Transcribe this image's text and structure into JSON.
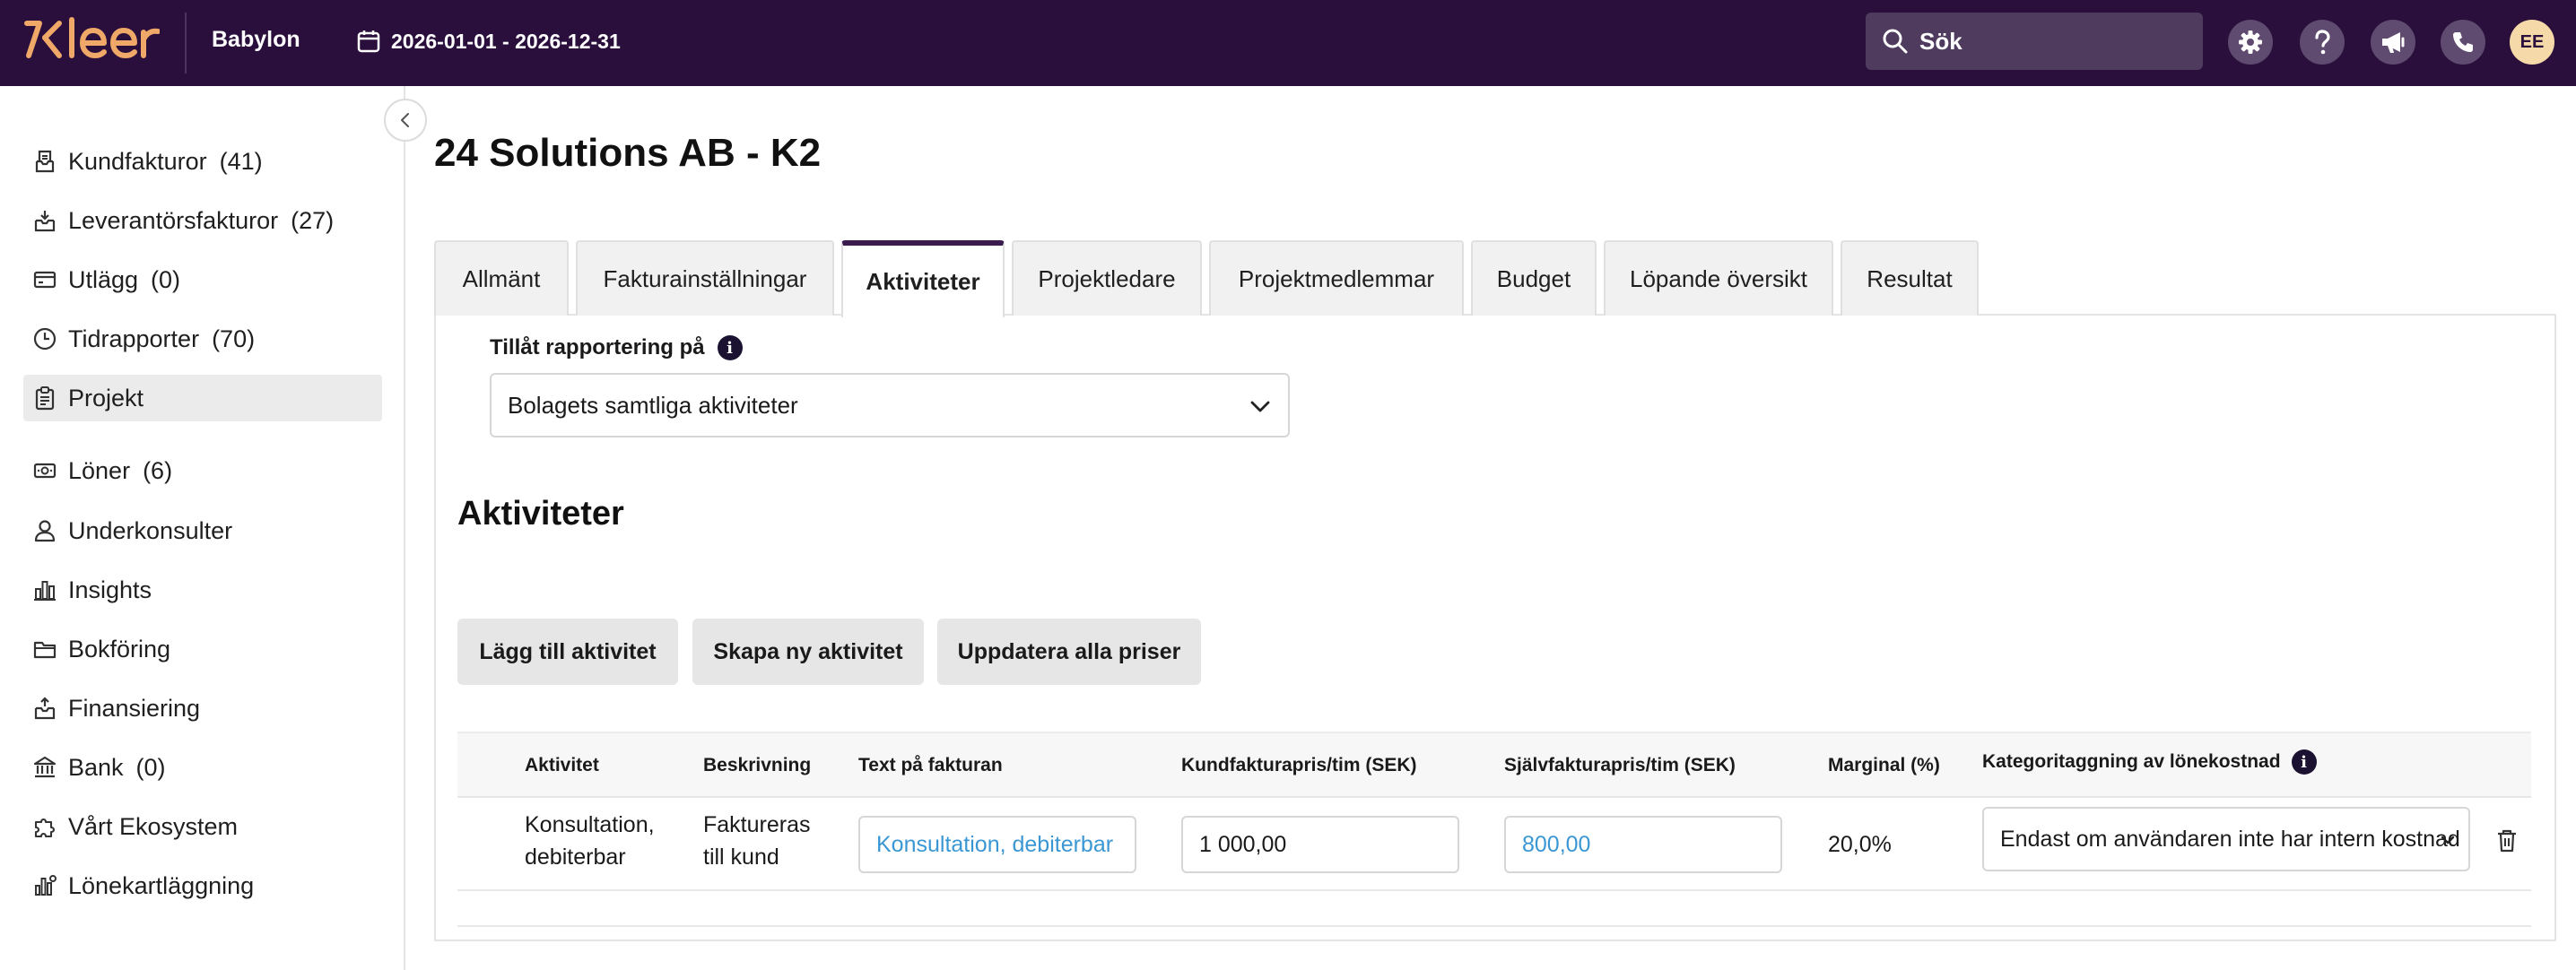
{
  "topbar": {
    "logo_text": "Kleer",
    "company": "Babylon",
    "period": "2026-01-01 - 2026-12-31",
    "search_placeholder": "Sök",
    "avatar_initials": "EE",
    "icons": [
      "gear-icon",
      "help-icon",
      "megaphone-icon",
      "phone-icon"
    ],
    "colors": {
      "bar": "#2a0f3c",
      "logo": "#f0a868"
    }
  },
  "sidebar": {
    "items": [
      {
        "label": "Kundfakturor",
        "count": "(41)",
        "icon": "invoice-icon"
      },
      {
        "label": "Leverantörsfakturor",
        "count": "(27)",
        "icon": "inbox-icon"
      },
      {
        "label": "Utlägg",
        "count": "(0)",
        "icon": "card-icon"
      },
      {
        "label": "Tidrapporter",
        "count": "(70)",
        "icon": "clock-icon"
      },
      {
        "label": "Projekt",
        "count": "",
        "icon": "clipboard-icon",
        "active": true
      },
      {
        "label": "Löner",
        "count": "(6)",
        "icon": "cash-icon"
      },
      {
        "label": "Underkonsulter",
        "count": "",
        "icon": "person-icon"
      },
      {
        "label": "Insights",
        "count": "",
        "icon": "bar-chart-icon"
      },
      {
        "label": "Bokföring",
        "count": "",
        "icon": "folder-icon"
      },
      {
        "label": "Finansiering",
        "count": "",
        "icon": "finance-icon"
      },
      {
        "label": "Bank",
        "count": "(0)",
        "icon": "bank-icon"
      },
      {
        "label": "Vårt Ekosystem",
        "count": "",
        "icon": "puzzle-icon"
      },
      {
        "label": "Lönekartläggning",
        "count": "",
        "icon": "salary-chart-icon"
      }
    ]
  },
  "main": {
    "title": "24 Solutions AB - K2",
    "tabs": [
      {
        "label": "Allmänt"
      },
      {
        "label": "Fakturainställningar"
      },
      {
        "label": "Aktiviteter",
        "active": true
      },
      {
        "label": "Projektledare"
      },
      {
        "label": "Projektmedlemmar"
      },
      {
        "label": "Budget"
      },
      {
        "label": "Löpande översikt"
      },
      {
        "label": "Resultat"
      }
    ],
    "reporting": {
      "label": "Tillåt rapportering på",
      "selected": "Bolagets samtliga aktiviteter"
    },
    "section_title": "Aktiviteter",
    "buttons": {
      "add": "Lägg till aktivitet",
      "create": "Skapa ny aktivitet",
      "update_prices": "Uppdatera alla priser"
    },
    "table": {
      "columns": {
        "activity": "Aktivitet",
        "description": "Beskrivning",
        "invoice_text": "Text på fakturan",
        "customer_price": "Kundfakturapris/tim (SEK)",
        "self_price": "Självfakturapris/tim (SEK)",
        "margin": "Marginal (%)",
        "category": "Kategoritaggning av lönekostnad"
      },
      "rows": [
        {
          "activity": "Konsultation, debiterbar",
          "description": "Faktureras till kund",
          "invoice_text": "Konsultation, debiterbar",
          "customer_price": "1 000,00",
          "self_price": "800,00",
          "margin": "20,0%",
          "category": "Endast om användaren inte har intern kostnad"
        }
      ]
    }
  }
}
